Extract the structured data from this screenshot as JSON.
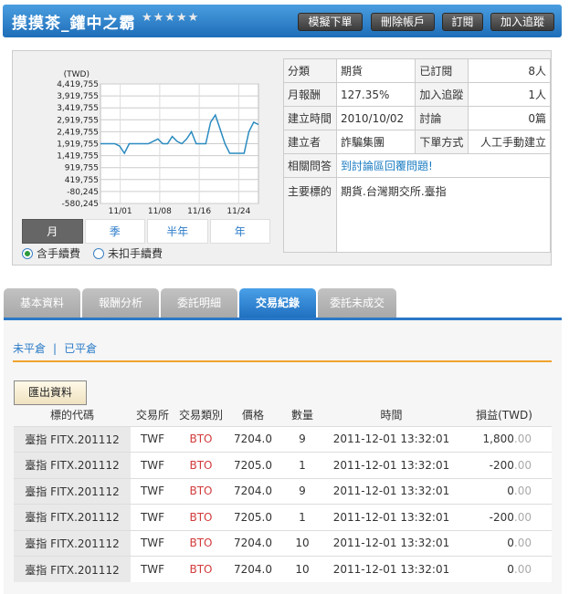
{
  "header": {
    "title": "摸摸茶_鑵中之霸",
    "stars": "★★★★★",
    "buttons": [
      "模擬下單",
      "刪除帳戶",
      "訂閱",
      "加入追蹤"
    ]
  },
  "chart_data": {
    "type": "line",
    "ylabel": "(TWD)",
    "y_ticks": [
      "4,419,755",
      "3,919,755",
      "3,419,755",
      "2,919,755",
      "2,419,755",
      "1,919,755",
      "1,419,755",
      "919,755",
      "419,755",
      "-80,245",
      "-580,245"
    ],
    "ylim": [
      -580245,
      4419755
    ],
    "x_ticks": [
      "11/01",
      "11/08",
      "11/16",
      "11/24"
    ],
    "grid": true,
    "color": "#2a8bc0",
    "series": [
      {
        "values": [
          1919755,
          1919755,
          1919755,
          1919755,
          1819755,
          1519755,
          1919755,
          1919755,
          1919755,
          1919755,
          1919755,
          2019755,
          2119755,
          1919755,
          1919755,
          2219755,
          2019755,
          1919755,
          2119755,
          2419755,
          1919755,
          1919755,
          1919755,
          2819755,
          3119755,
          2519755,
          1919755,
          1519755,
          1519755,
          1519755,
          1519755,
          2419755,
          2819755,
          2719755
        ]
      }
    ]
  },
  "periods": [
    "月",
    "季",
    "半年",
    "年"
  ],
  "fee_options": [
    "含手續費",
    "未扣手續費"
  ],
  "info": {
    "rows": [
      {
        "k1": "分類",
        "v1": "期貨",
        "k2": "已訂閱",
        "v2": "8人"
      },
      {
        "k1": "月報酬",
        "v1": "127.35%",
        "k2": "加入追蹤",
        "v2": "1人"
      },
      {
        "k1": "建立時間",
        "v1": "2010/10/02",
        "k2": "討論",
        "v2": "0篇"
      },
      {
        "k1": "建立者",
        "v1": "詐騙集團",
        "k2": "下單方式",
        "v2": "人工手動建立"
      }
    ],
    "qa_label": "相關問答",
    "qa_link": "到討論區回覆問題!",
    "target_label": "主要標的",
    "target_value": "期貨.台灣期交所.臺指"
  },
  "tabs": [
    "基本資料",
    "報酬分析",
    "委託明細",
    "交易紀錄",
    "委託未成交"
  ],
  "subnav": {
    "open": "未平倉",
    "closed": "已平倉"
  },
  "export_label": "匯出資料",
  "table": {
    "headers": [
      "標的代碼",
      "交易所",
      "交易類別",
      "價格",
      "數量",
      "時間",
      "損益(TWD)"
    ],
    "rows": [
      {
        "code": "臺指 FITX.201112",
        "ex": "TWF",
        "type": "BTO",
        "price": "7204.0",
        "qty": "9",
        "time": "2011-12-01 13:32:01",
        "pl_int": "1,800",
        "pl_dec": ".00"
      },
      {
        "code": "臺指 FITX.201112",
        "ex": "TWF",
        "type": "BTO",
        "price": "7205.0",
        "qty": "1",
        "time": "2011-12-01 13:32:01",
        "pl_int": "-200",
        "pl_dec": ".00"
      },
      {
        "code": "臺指 FITX.201112",
        "ex": "TWF",
        "type": "BTO",
        "price": "7204.0",
        "qty": "9",
        "time": "2011-12-01 13:32:01",
        "pl_int": "0",
        "pl_dec": ".00"
      },
      {
        "code": "臺指 FITX.201112",
        "ex": "TWF",
        "type": "BTO",
        "price": "7205.0",
        "qty": "1",
        "time": "2011-12-01 13:32:01",
        "pl_int": "-200",
        "pl_dec": ".00"
      },
      {
        "code": "臺指 FITX.201112",
        "ex": "TWF",
        "type": "BTO",
        "price": "7204.0",
        "qty": "10",
        "time": "2011-12-01 13:32:01",
        "pl_int": "0",
        "pl_dec": ".00"
      },
      {
        "code": "臺指 FITX.201112",
        "ex": "TWF",
        "type": "BTO",
        "price": "7204.0",
        "qty": "10",
        "time": "2011-12-01 13:32:01",
        "pl_int": "0",
        "pl_dec": ".00"
      }
    ]
  }
}
